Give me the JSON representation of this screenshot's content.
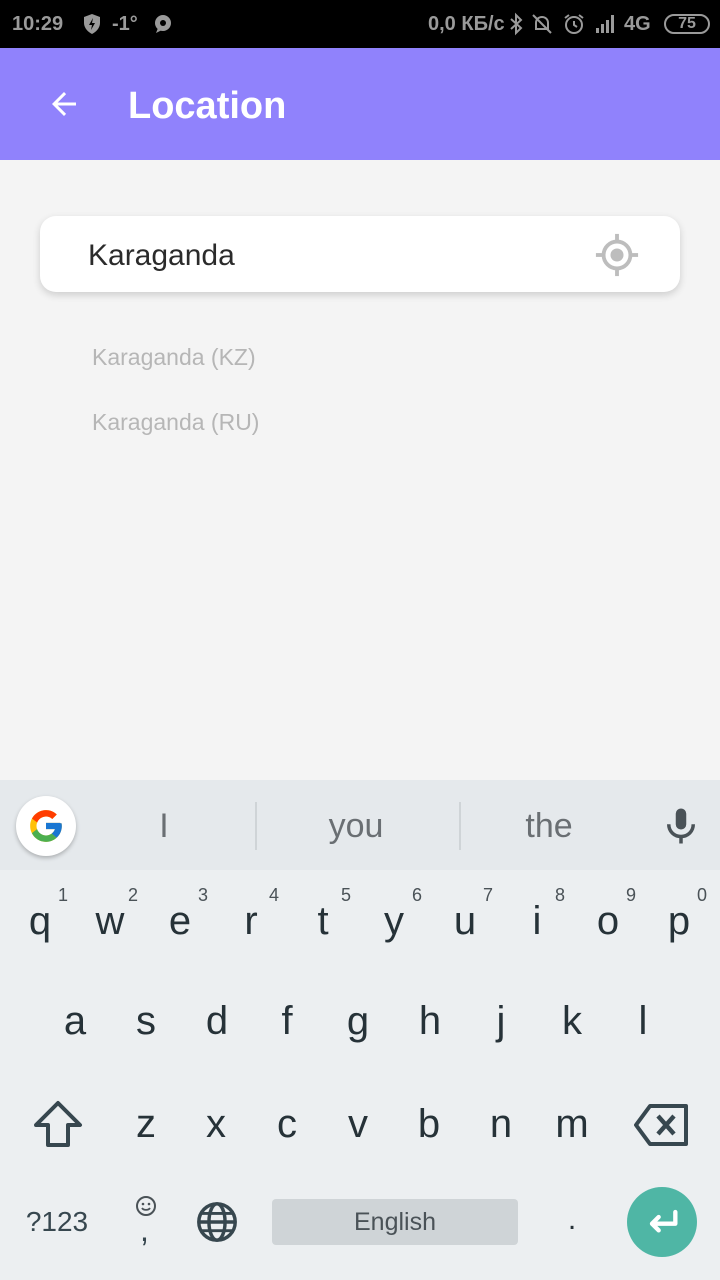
{
  "status_bar": {
    "time": "10:29",
    "temperature": "-1°",
    "net_speed": "0,0 КБ/с",
    "network": "4G",
    "battery": "75",
    "icons": [
      "bolt-shield-icon",
      "chat-bubble-icon",
      "bluetooth-icon",
      "alarm-off-icon",
      "alarm-icon",
      "signal-icon",
      "battery-icon"
    ]
  },
  "app_bar": {
    "title": "Location",
    "background": "#9082fc",
    "back_icon": "arrow-back-icon"
  },
  "search": {
    "value": "Karaganda",
    "locate_icon": "gps-locate-icon"
  },
  "suggestions": [
    "Karaganda (KZ)",
    "Karaganda (RU)"
  ],
  "keyboard": {
    "word_suggestions": [
      "I",
      "you",
      "the"
    ],
    "row1": [
      {
        "key": "q",
        "num": "1"
      },
      {
        "key": "w",
        "num": "2"
      },
      {
        "key": "e",
        "num": "3"
      },
      {
        "key": "r",
        "num": "4"
      },
      {
        "key": "t",
        "num": "5"
      },
      {
        "key": "y",
        "num": "6"
      },
      {
        "key": "u",
        "num": "7"
      },
      {
        "key": "i",
        "num": "8"
      },
      {
        "key": "o",
        "num": "9"
      },
      {
        "key": "p",
        "num": "0"
      }
    ],
    "row2": [
      "a",
      "s",
      "d",
      "f",
      "g",
      "h",
      "j",
      "k",
      "l"
    ],
    "row3": [
      "z",
      "x",
      "c",
      "v",
      "b",
      "n",
      "m"
    ],
    "symbols_label": "?123",
    "comma_label": ",",
    "space_label": "English",
    "period_label": ".",
    "enter_color": "#4fb6a5"
  }
}
